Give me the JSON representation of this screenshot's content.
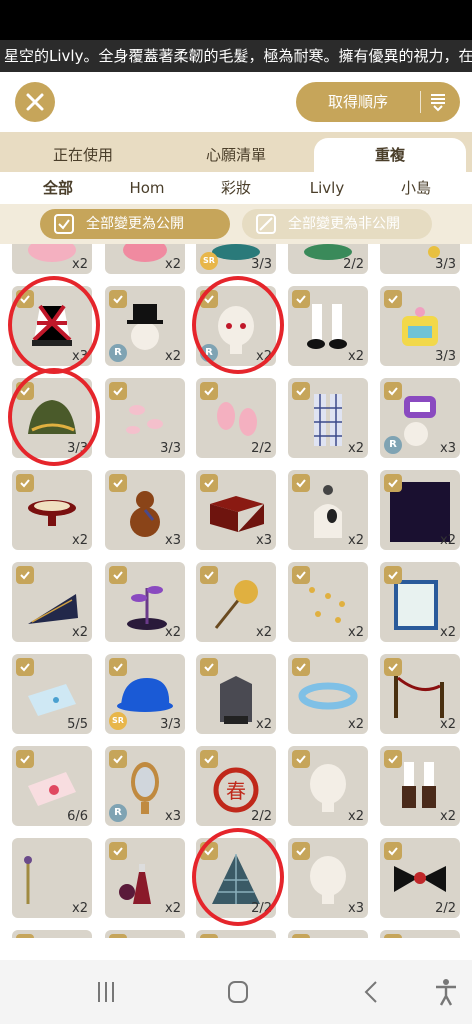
{
  "marquee": {
    "text": "星空的Livly。全身覆蓋著柔韌的毛髮，極為耐寒。擁有優異的視力，在"
  },
  "toolbar": {
    "sort_label": "取得順序"
  },
  "tabs": [
    {
      "label": "正在使用",
      "active": false
    },
    {
      "label": "心願清單",
      "active": false
    },
    {
      "label": "重複",
      "active": true
    }
  ],
  "subtabs": [
    {
      "label": "全部",
      "active": true
    },
    {
      "label": "Hom",
      "active": false
    },
    {
      "label": "彩妝",
      "active": false
    },
    {
      "label": "Livly",
      "active": false
    },
    {
      "label": "小島",
      "active": false
    }
  ],
  "filters": {
    "public_label": "全部變更為公開",
    "private_label": "全部變更為非公開"
  },
  "colors": {
    "accent": "#c6a55a",
    "cell_bg": "#d9d4ca",
    "marker": "#e5252b"
  },
  "items": [
    {
      "name": "pink-snail",
      "count": "x2",
      "checked": true,
      "rarity": ""
    },
    {
      "name": "pink-creature",
      "count": "x2",
      "checked": true,
      "rarity": ""
    },
    {
      "name": "green-bowl",
      "count": "3/3",
      "checked": true,
      "rarity": "SR"
    },
    {
      "name": "green-plant",
      "count": "2/2",
      "checked": true,
      "rarity": ""
    },
    {
      "name": "yellow-item",
      "count": "3/3",
      "checked": true,
      "rarity": ""
    },
    {
      "name": "red-diamond-lampshade",
      "count": "x3",
      "checked": true,
      "rarity": "",
      "circled": true
    },
    {
      "name": "top-hat-head",
      "count": "x2",
      "checked": true,
      "rarity": "R"
    },
    {
      "name": "red-eye-head",
      "count": "x2",
      "checked": true,
      "rarity": "R",
      "circled": true
    },
    {
      "name": "white-socks-shoes",
      "count": "x2",
      "checked": true,
      "rarity": ""
    },
    {
      "name": "yellow-machine",
      "count": "3/3",
      "checked": true,
      "rarity": ""
    },
    {
      "name": "green-hat",
      "count": "3/3",
      "checked": true,
      "rarity": "",
      "circled": true
    },
    {
      "name": "pink-petals-small",
      "count": "3/3",
      "checked": true,
      "rarity": ""
    },
    {
      "name": "pink-petals-large",
      "count": "2/2",
      "checked": true,
      "rarity": ""
    },
    {
      "name": "plaid-pants",
      "count": "x2",
      "checked": true,
      "rarity": ""
    },
    {
      "name": "purple-robot-head",
      "count": "x3",
      "checked": true,
      "rarity": "R"
    },
    {
      "name": "red-bowl",
      "count": "x2",
      "checked": true,
      "rarity": ""
    },
    {
      "name": "gourd",
      "count": "x3",
      "checked": true,
      "rarity": ""
    },
    {
      "name": "red-table",
      "count": "x3",
      "checked": true,
      "rarity": ""
    },
    {
      "name": "necklace-bust",
      "count": "x2",
      "checked": true,
      "rarity": ""
    },
    {
      "name": "night-background",
      "count": "x2",
      "checked": true,
      "rarity": ""
    },
    {
      "name": "black-fan",
      "count": "x2",
      "checked": true,
      "rarity": ""
    },
    {
      "name": "purple-sprout",
      "count": "x2",
      "checked": true,
      "rarity": ""
    },
    {
      "name": "golden-wand",
      "count": "x2",
      "checked": true,
      "rarity": ""
    },
    {
      "name": "gold-flakes",
      "count": "x2",
      "checked": true,
      "rarity": ""
    },
    {
      "name": "sign-board",
      "count": "x2",
      "checked": true,
      "rarity": ""
    },
    {
      "name": "blue-envelope",
      "count": "5/5",
      "checked": true,
      "rarity": ""
    },
    {
      "name": "blue-livly-cap",
      "count": "3/3",
      "checked": true,
      "rarity": "SR"
    },
    {
      "name": "grey-coat",
      "count": "x2",
      "checked": true,
      "rarity": ""
    },
    {
      "name": "blue-flower-ring",
      "count": "x2",
      "checked": true,
      "rarity": ""
    },
    {
      "name": "rope-barrier",
      "count": "x2",
      "checked": true,
      "rarity": ""
    },
    {
      "name": "pink-letter",
      "count": "6/6",
      "checked": true,
      "rarity": ""
    },
    {
      "name": "gold-mirror",
      "count": "x3",
      "checked": true,
      "rarity": "R"
    },
    {
      "name": "spring-lantern",
      "count": "2/2",
      "checked": true,
      "rarity": ""
    },
    {
      "name": "white-head",
      "count": "x2",
      "checked": true,
      "rarity": ""
    },
    {
      "name": "brown-boots",
      "count": "x2",
      "checked": true,
      "rarity": ""
    },
    {
      "name": "candelabra",
      "count": "x2",
      "checked": false,
      "rarity": ""
    },
    {
      "name": "potion-bottles",
      "count": "x2",
      "checked": true,
      "rarity": ""
    },
    {
      "name": "teal-cone-hat",
      "count": "2/2",
      "checked": true,
      "rarity": "",
      "circled": true
    },
    {
      "name": "sleepy-head",
      "count": "x3",
      "checked": true,
      "rarity": ""
    },
    {
      "name": "black-bow",
      "count": "2/2",
      "checked": true,
      "rarity": ""
    },
    {
      "name": "partial-a",
      "count": "",
      "checked": true,
      "rarity": ""
    },
    {
      "name": "partial-b",
      "count": "",
      "checked": true,
      "rarity": ""
    },
    {
      "name": "partial-c",
      "count": "",
      "checked": true,
      "rarity": ""
    },
    {
      "name": "partial-d",
      "count": "",
      "checked": true,
      "rarity": ""
    },
    {
      "name": "partial-e",
      "count": "",
      "checked": true,
      "rarity": ""
    }
  ]
}
